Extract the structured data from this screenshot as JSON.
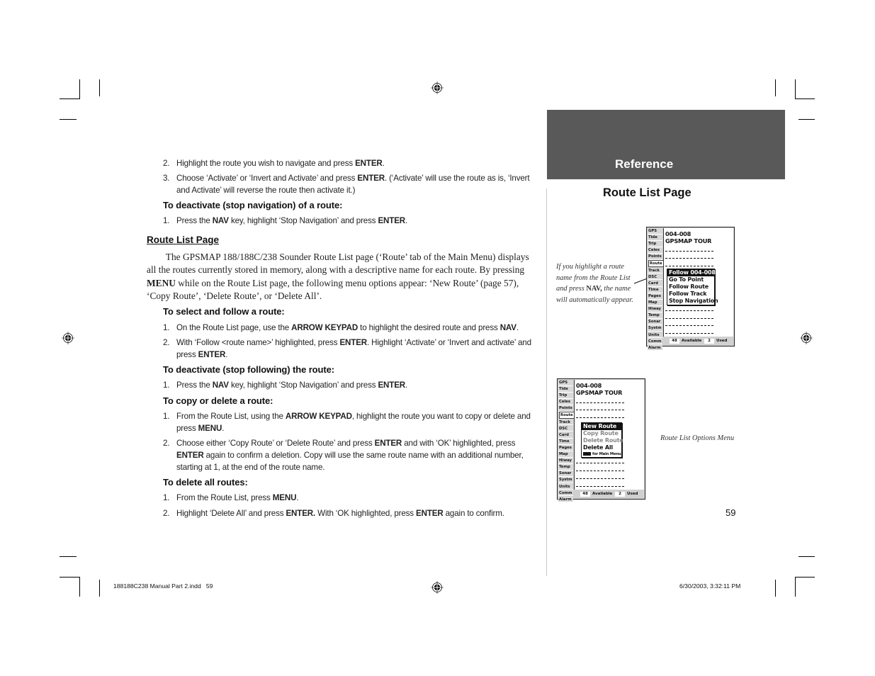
{
  "left": {
    "intro_items": [
      {
        "num": "2.",
        "parts": [
          [
            "t",
            "Highlight the route you wish to navigate and press "
          ],
          [
            "b",
            "ENTER"
          ],
          [
            "t",
            "."
          ]
        ]
      },
      {
        "num": "3.",
        "parts": [
          [
            "t",
            "Choose ‘Activate’ or ‘Invert and Activate’ and press "
          ],
          [
            "b",
            "ENTER"
          ],
          [
            "t",
            ". (‘Activate’ will use the route as is, ‘Invert and Activate’ will reverse the route then activate it.)"
          ]
        ]
      }
    ],
    "deactivate_nav_heading": "To deactivate (stop navigation) of a route:",
    "deactivate_nav_items": [
      {
        "num": "1.",
        "parts": [
          [
            "t",
            "Press the "
          ],
          [
            "b",
            "NAV"
          ],
          [
            "t",
            " key, highlight ‘Stop Navigation’ and press "
          ],
          [
            "b",
            "ENTER"
          ],
          [
            "t",
            "."
          ]
        ]
      }
    ],
    "section_heading": "Route List Page",
    "section_body": [
      [
        "t",
        "  The GPSMAP 188/188C/238 Sounder Route List page (‘Route’ tab of the Main Menu) displays all the routes currently stored in memory, along with a descriptive name for each route. By pressing "
      ],
      [
        "b",
        "MENU"
      ],
      [
        "t",
        " while on the Route List page, the following menu options appear: ‘New Route’ (page 57), ‘Copy Route’, ‘Delete Route’, or ‘Delete All’."
      ]
    ],
    "select_heading": "To select and follow a route:",
    "select_items": [
      {
        "num": "1.",
        "parts": [
          [
            "t",
            "On the Route List page, use the "
          ],
          [
            "b",
            "ARROW KEYPAD"
          ],
          [
            "t",
            " to highlight the desired route and press "
          ],
          [
            "b",
            "NAV"
          ],
          [
            "t",
            "."
          ]
        ]
      },
      {
        "num": "2.",
        "parts": [
          [
            "t",
            "With ‘Follow <route name>’ highlighted, press "
          ],
          [
            "b",
            "ENTER"
          ],
          [
            "t",
            ". Highlight ‘Activate’ or ‘Invert and activate’ and press "
          ],
          [
            "b",
            "ENTER"
          ],
          [
            "t",
            "."
          ]
        ]
      }
    ],
    "deactivate_follow_heading": "To deactivate (stop following) the route:",
    "deactivate_follow_items": [
      {
        "num": "1.",
        "parts": [
          [
            "t",
            "Press the "
          ],
          [
            "b",
            "NAV"
          ],
          [
            "t",
            " key, highlight ‘Stop Navigation’ and press "
          ],
          [
            "b",
            "ENTER"
          ],
          [
            "t",
            "."
          ]
        ]
      }
    ],
    "copy_heading": "To copy or delete a route:",
    "copy_items": [
      {
        "num": "1.",
        "parts": [
          [
            "t",
            "From the Route List, using the "
          ],
          [
            "b",
            "ARROW KEYPAD"
          ],
          [
            "t",
            ", highlight the route you want to copy or delete and press "
          ],
          [
            "b",
            "MENU"
          ],
          [
            "t",
            "."
          ]
        ]
      },
      {
        "num": "2.",
        "parts": [
          [
            "t",
            "Choose either ‘Copy Route’ or ‘Delete Route’ and press "
          ],
          [
            "b",
            "ENTER"
          ],
          [
            "t",
            " and with ‘OK’ highlighted, press "
          ],
          [
            "b",
            "ENTER"
          ],
          [
            "t",
            " again to confirm a deletion. Copy will use the same route name with an additional number, starting at 1, at the end of the route name."
          ]
        ]
      }
    ],
    "delete_all_heading": "To delete all routes:",
    "delete_all_items": [
      {
        "num": "1.",
        "parts": [
          [
            "t",
            "From the Route List, press "
          ],
          [
            "b",
            "MENU"
          ],
          [
            "t",
            "."
          ]
        ]
      },
      {
        "num": "2.",
        "parts": [
          [
            "t",
            "Highlight ‘Delete All’ and press "
          ],
          [
            "b",
            "ENTER."
          ],
          [
            "t",
            " With ‘OK highlighted, press "
          ],
          [
            "b",
            "ENTER"
          ],
          [
            "t",
            " again to confirm."
          ]
        ]
      }
    ]
  },
  "right": {
    "tab_label": "Reference",
    "title": "Route List Page",
    "caption1": [
      [
        "t",
        "If you highlight a route name from the Route List and press "
      ],
      [
        "b",
        "NAV,"
      ],
      [
        "t",
        " the name will automatically appear."
      ]
    ],
    "caption2": "Route List Options Menu",
    "page_number": "59"
  },
  "screen": {
    "tabs": [
      "GPS",
      "Tide",
      "Trip",
      "Celes",
      "Points",
      "Route",
      "Track",
      "DSC",
      "Card",
      "Time",
      "Pages",
      "Map",
      "Hiway",
      "Temp",
      "Sonar",
      "Systm",
      "Units",
      "Comm",
      "Alarm"
    ],
    "selected_tab": "Route",
    "route_id": "004-008",
    "route_name": "GPSMAP TOUR",
    "available_count": "48",
    "available_label": "Available",
    "used_count": "2",
    "used_label": "Used"
  },
  "nav_menu": {
    "items": [
      {
        "label": "Follow 004-008",
        "state": "highlighted"
      },
      {
        "label": "Go To Point",
        "state": "normal"
      },
      {
        "label": "Follow Route",
        "state": "normal"
      },
      {
        "label": "Follow Track",
        "state": "normal"
      },
      {
        "label": "Stop Navigation",
        "state": "normal"
      }
    ]
  },
  "options_menu": {
    "items": [
      {
        "label": "New Route",
        "state": "highlighted"
      },
      {
        "label": "Copy Route",
        "state": "disabled"
      },
      {
        "label": "Delete Route",
        "state": "disabled"
      },
      {
        "label": "Delete All",
        "state": "normal"
      }
    ],
    "hint": "for Main Menu"
  },
  "footer": {
    "file_info": "188188C238 Manual Part 2.indd   59",
    "timestamp": "6/30/2003, 3:32:11 PM"
  }
}
